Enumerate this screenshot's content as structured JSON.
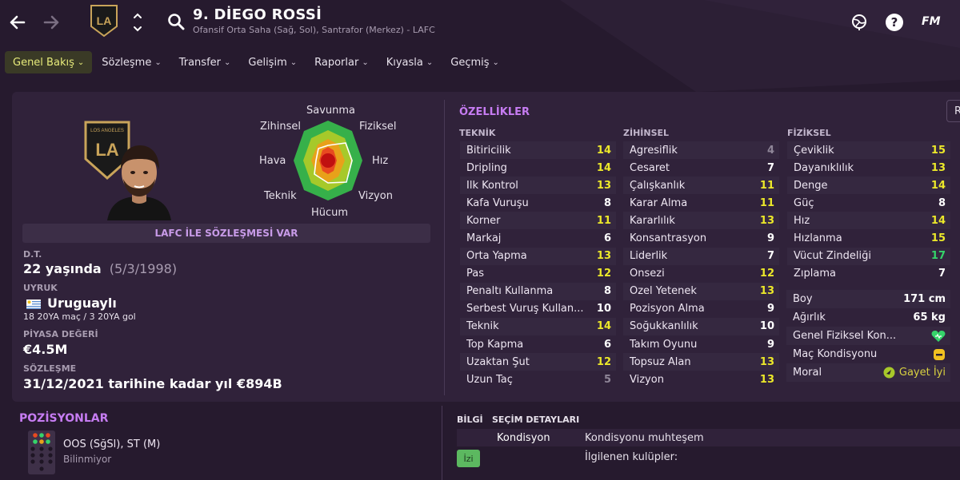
{
  "header": {
    "player_name": "9. DİEGO ROSSİ",
    "player_subtitle": "Ofansif Orta Saha (Sağ, Sol), Santrafor (Merkez) - LAFC",
    "fm_logo": "FM",
    "icons": [
      "back-arrow-icon",
      "forward-arrow-icon",
      "club-crest-icon",
      "up-down-icon",
      "search-icon",
      "world-icon",
      "help-icon"
    ]
  },
  "tabs": [
    {
      "label": "Genel Bakış",
      "active": true
    },
    {
      "label": "Sözleşme"
    },
    {
      "label": "Transfer"
    },
    {
      "label": "Gelişim"
    },
    {
      "label": "Raporlar"
    },
    {
      "label": "Kıyasla"
    },
    {
      "label": "Geçmiş"
    }
  ],
  "radar": {
    "labels": {
      "top": "Savunma",
      "top_right": "Fiziksel",
      "right": "Hız",
      "bottom_right": "Vizyon",
      "bottom": "Hücum",
      "bottom_left": "Teknik",
      "left": "Hava",
      "top_left": "Zihinsel"
    }
  },
  "profile": {
    "contract_banner": "LAFC İLE SÖZLEŞMESİ VAR",
    "dob_label": "D.T.",
    "age": "22 yaşında",
    "dob": "(5/3/1998)",
    "nationality_label": "UYRUK",
    "nationality": "Uruguaylı",
    "caps": "18 20YA maç / 3 20YA gol",
    "value_label": "PİYASA DEĞERİ",
    "value": "€4.5M",
    "contract_label": "SÖZLEŞME",
    "contract": "31/12/2021 tarihine kadar yıl €894B"
  },
  "attributes": {
    "title": "ÖZELLİKLER",
    "side_button": "R",
    "teknik": {
      "header": "TEKNİK",
      "rows": [
        {
          "name": "Bitiricilik",
          "value": "14",
          "tone": "yellow"
        },
        {
          "name": "Dripling",
          "value": "14",
          "tone": "yellow"
        },
        {
          "name": "İlk Kontrol",
          "value": "13",
          "tone": "yellow"
        },
        {
          "name": "Kafa Vuruşu",
          "value": "8",
          "tone": "white"
        },
        {
          "name": "Korner",
          "value": "11",
          "tone": "yellow"
        },
        {
          "name": "Markaj",
          "value": "6",
          "tone": "white"
        },
        {
          "name": "Orta Yapma",
          "value": "13",
          "tone": "yellow"
        },
        {
          "name": "Pas",
          "value": "12",
          "tone": "yellow"
        },
        {
          "name": "Penaltı Kullanma",
          "value": "8",
          "tone": "white"
        },
        {
          "name": "Serbest Vuruş Kullan...",
          "value": "10",
          "tone": "white"
        },
        {
          "name": "Teknik",
          "value": "14",
          "tone": "yellow"
        },
        {
          "name": "Top Kapma",
          "value": "6",
          "tone": "white"
        },
        {
          "name": "Uzaktan Şut",
          "value": "12",
          "tone": "yellow"
        },
        {
          "name": "Uzun Taç",
          "value": "5",
          "tone": "gray"
        }
      ]
    },
    "zihinsel": {
      "header": "ZİHİNSEL",
      "rows": [
        {
          "name": "Agresiflik",
          "value": "4",
          "tone": "gray"
        },
        {
          "name": "Cesaret",
          "value": "7",
          "tone": "white"
        },
        {
          "name": "Çalışkanlık",
          "value": "11",
          "tone": "yellow"
        },
        {
          "name": "Karar Alma",
          "value": "11",
          "tone": "yellow"
        },
        {
          "name": "Kararlılık",
          "value": "13",
          "tone": "yellow"
        },
        {
          "name": "Konsantrasyon",
          "value": "9",
          "tone": "white"
        },
        {
          "name": "Liderlik",
          "value": "7",
          "tone": "white"
        },
        {
          "name": "Önsezi",
          "value": "12",
          "tone": "yellow"
        },
        {
          "name": "Özel Yetenek",
          "value": "13",
          "tone": "yellow"
        },
        {
          "name": "Pozisyon Alma",
          "value": "9",
          "tone": "white"
        },
        {
          "name": "Soğukkanlılık",
          "value": "10",
          "tone": "white"
        },
        {
          "name": "Takım Oyunu",
          "value": "9",
          "tone": "white"
        },
        {
          "name": "Topsuz Alan",
          "value": "13",
          "tone": "yellow"
        },
        {
          "name": "Vizyon",
          "value": "13",
          "tone": "yellow"
        }
      ]
    },
    "fiziksel": {
      "header": "FİZİKSEL",
      "rows": [
        {
          "name": "Çeviklik",
          "value": "15",
          "tone": "yellow"
        },
        {
          "name": "Dayanıklılık",
          "value": "13",
          "tone": "yellow"
        },
        {
          "name": "Denge",
          "value": "14",
          "tone": "yellow"
        },
        {
          "name": "Güç",
          "value": "8",
          "tone": "white"
        },
        {
          "name": "Hız",
          "value": "14",
          "tone": "yellow"
        },
        {
          "name": "Hızlanma",
          "value": "15",
          "tone": "yellow"
        },
        {
          "name": "Vücut Zindeliği",
          "value": "17",
          "tone": "green"
        },
        {
          "name": "Zıplama",
          "value": "7",
          "tone": "white"
        }
      ]
    },
    "physical_info": [
      {
        "name": "Boy",
        "value": "171 cm"
      },
      {
        "name": "Ağırlık",
        "value": "65 kg"
      },
      {
        "name": "Genel Fiziksel Kon...",
        "value": "",
        "icon": "heart-icon"
      },
      {
        "name": "Maç Kondisyonu",
        "value": "",
        "icon": "condition-icon"
      },
      {
        "name": "Moral",
        "value": "Gayet İyi",
        "icon": "morale-icon"
      }
    ]
  },
  "positions": {
    "title": "POZİSYONLAR",
    "line1": "OOS (SğSl), ST (M)",
    "line2": "Bilinmiyor"
  },
  "info": {
    "tab_info": "BİLGİ",
    "tab_selection": "SEÇİM DETAYLARI",
    "row1_label": "Kondisyon",
    "row1_value": "Kondisyonu muhteşem",
    "row2_value": "İlgilenen kulüpler:",
    "badge": "İzi"
  },
  "colors": {
    "background": "#261a2e",
    "panel": "#30223a",
    "accent_purple": "#c67cf2",
    "value_yellow": "#ece82a",
    "value_green": "#35d46a",
    "active_tab": "#e6ea7a"
  }
}
